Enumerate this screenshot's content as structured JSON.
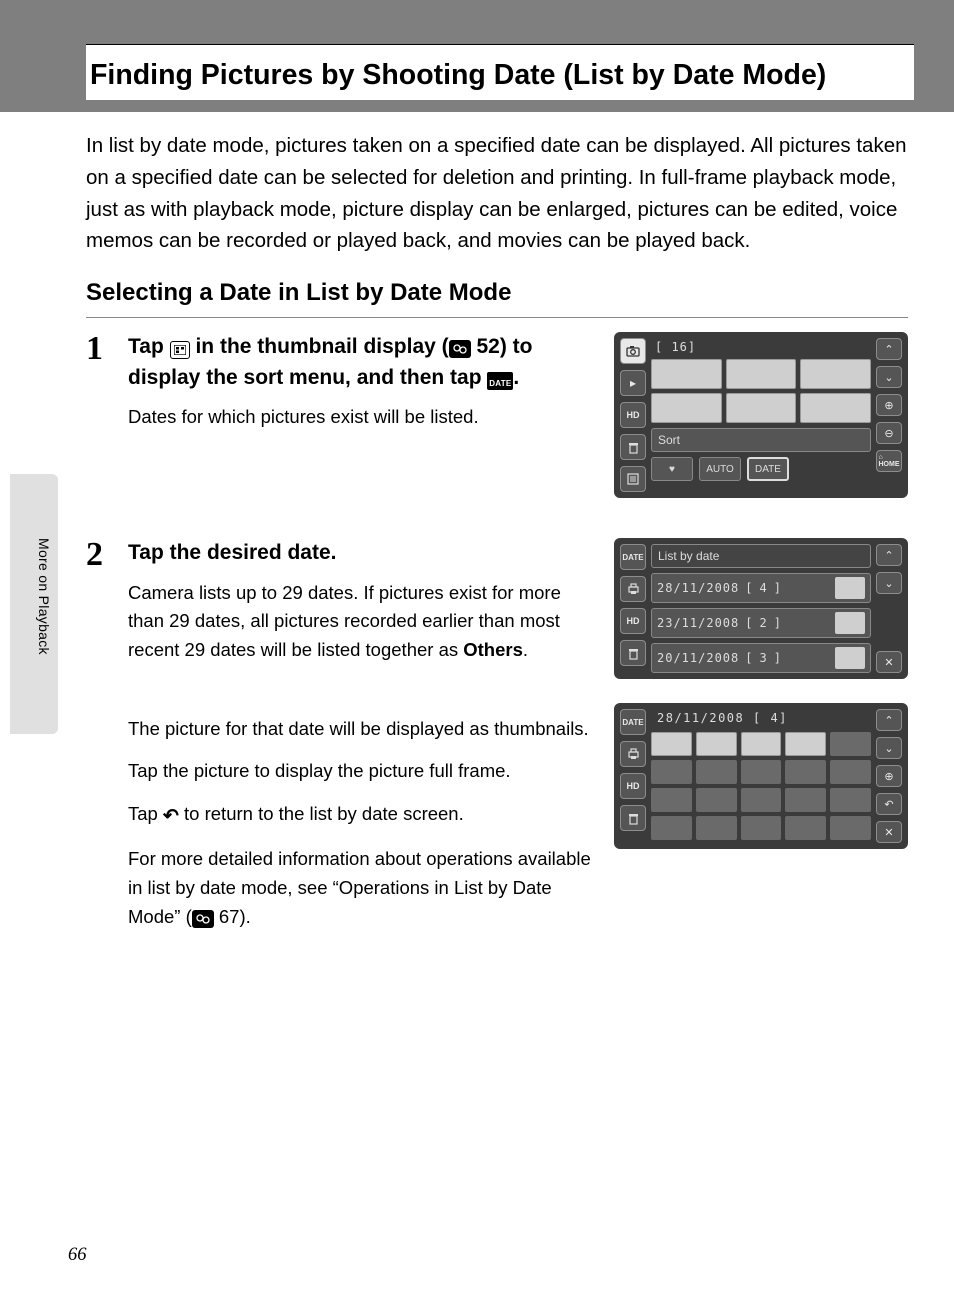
{
  "page": {
    "number": "66",
    "section_tab": "More on Playback"
  },
  "title": "Finding Pictures by Shooting Date (List by Date Mode)",
  "intro": "In list by date mode, pictures taken on a specified date can be displayed. All pictures taken on a specified date can be selected for deletion and printing. In full-frame playback mode, just as with playback mode, picture display can be enlarged, pictures can be edited, voice memos can be recorded or played back, and movies can be played back.",
  "subhead": "Selecting a Date in List by Date Mode",
  "steps": [
    {
      "num": "1",
      "head_prefix": "Tap ",
      "head_mid1": " in the thumbnail display (",
      "head_pageref": " 52) to display the sort menu, and then tap ",
      "head_suffix": ".",
      "body_paras": [
        "Dates for which pictures exist will be listed."
      ]
    },
    {
      "num": "2",
      "head_full": "Tap the desired date.",
      "body_paras": [
        "Camera lists up to 29 dates. If pictures exist for more than 29 dates, all pictures recorded earlier than most recent 29 dates will be listed together as ",
        "Others",
        ".",
        "The picture for that date will be displayed as thumbnails.",
        "Tap the picture to display the picture full frame.",
        "Tap ",
        " to return to the list by date screen.",
        "For more detailed information about operations available in list by date mode, see “Operations in List by Date Mode” (",
        " 67)."
      ]
    }
  ],
  "screens": {
    "thumb_count": "16",
    "sort_label": "Sort",
    "sort_options": {
      "auto": "AUTO",
      "date": "DATE"
    },
    "list_title": "List by date",
    "date_rows": [
      {
        "date": "28/11/2008",
        "count": "4"
      },
      {
        "date": "23/11/2008",
        "count": "2"
      },
      {
        "date": "20/11/2008",
        "count": "3"
      }
    ],
    "grid_header": {
      "date": "28/11/2008",
      "count": "4"
    }
  },
  "icons": {
    "camera": "A",
    "date_label": "DATE",
    "home": "HOME"
  }
}
